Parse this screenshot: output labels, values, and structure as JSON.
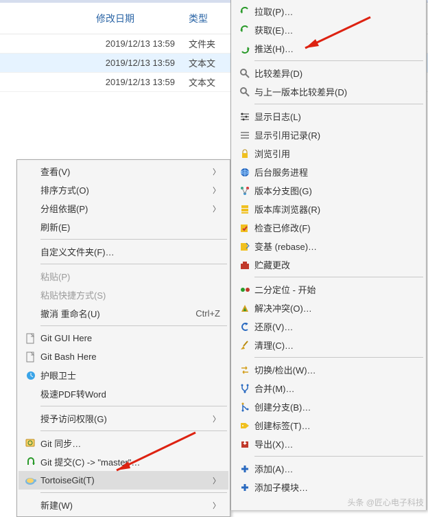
{
  "bg": {
    "headers": {
      "date": "修改日期",
      "type": "类型"
    },
    "rows": [
      {
        "date": "2019/12/13 13:59",
        "type": "文件夹"
      },
      {
        "date": "2019/12/13 13:59",
        "type": "文本文"
      },
      {
        "date": "2019/12/13 13:59",
        "type": "文本文"
      }
    ]
  },
  "leftMenu": {
    "view": "查看(V)",
    "sort": "排序方式(O)",
    "group": "分组依据(P)",
    "refresh": "刷新(E)",
    "custom_folder": "自定义文件夹(F)…",
    "paste": "粘贴(P)",
    "paste_shortcut": "粘贴快捷方式(S)",
    "undo_rename": "撤消 重命名(U)",
    "undo_key": "Ctrl+Z",
    "git_gui": "Git GUI Here",
    "git_bash": "Git Bash Here",
    "eye_guard": "护眼卫士",
    "pdf_word": "极速PDF转Word",
    "grant_access": "授予访问权限(G)",
    "git_sync": "Git 同步…",
    "git_commit": "Git 提交(C) -> \"master\"…",
    "tortoise": "TortoiseGit(T)",
    "new": "新建(W)"
  },
  "rightMenu": {
    "pull": "拉取(P)…",
    "fetch": "获取(E)…",
    "push": "推送(H)…",
    "diff": "比较差异(D)",
    "diff_prev": "与上一版本比较差异(D)",
    "show_log": "显示日志(L)",
    "reflog": "显示引用记录(R)",
    "repo_browser": "浏览引用",
    "daemon": "后台服务进程",
    "rev_graph": "版本分支图(G)",
    "repo_browse": "版本库浏览器(R)",
    "check_mod": "检查已修改(F)",
    "rebase": "变基 (rebase)…",
    "stash": "贮藏更改",
    "bisect": "二分定位 - 开始",
    "resolve": "解决冲突(O)…",
    "revert": "还原(V)…",
    "cleanup": "清理(C)…",
    "switch": "切换/检出(W)…",
    "merge": "合并(M)…",
    "branch": "创建分支(B)…",
    "tag": "创建标签(T)…",
    "export": "导出(X)…",
    "add": "添加(A)…",
    "submodule": "添加子模块…"
  },
  "watermark": "头条 @匠心电子科技"
}
